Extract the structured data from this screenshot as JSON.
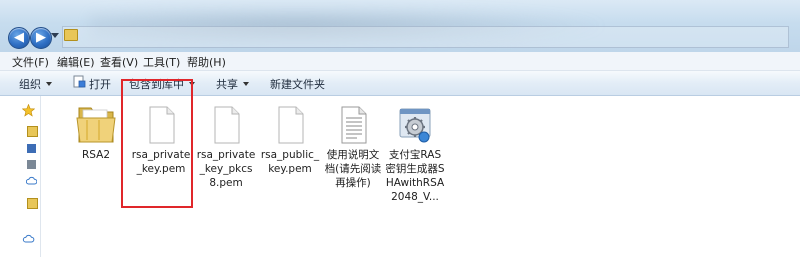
{
  "menubar": {
    "items": [
      {
        "label": "文件(F)"
      },
      {
        "label": "编辑(E)"
      },
      {
        "label": "查看(V)"
      },
      {
        "label": "工具(T)"
      },
      {
        "label": "帮助(H)"
      }
    ]
  },
  "toolbar": {
    "organize": "组织",
    "open": "打开",
    "include_in_library": "包含到库中",
    "share": "共享",
    "new_folder": "新建文件夹"
  },
  "files": [
    {
      "name": "RSA2",
      "icon": "folder-icon"
    },
    {
      "name": "rsa_private_key.pem",
      "icon": "document-icon"
    },
    {
      "name": "rsa_private_key_pkcs8.pem",
      "icon": "document-icon"
    },
    {
      "name": "rsa_public_key.pem",
      "icon": "document-icon"
    },
    {
      "name": "使用说明文档(请先阅读再操作)",
      "icon": "text-document-icon"
    },
    {
      "name": "支付宝RAS密钥生成器SHAwithRSA2048_V...",
      "icon": "application-gear-icon"
    }
  ],
  "colors": {
    "highlight": "#e0262a",
    "nav_button": "#2f6fc4",
    "folder": "#e8c658"
  }
}
